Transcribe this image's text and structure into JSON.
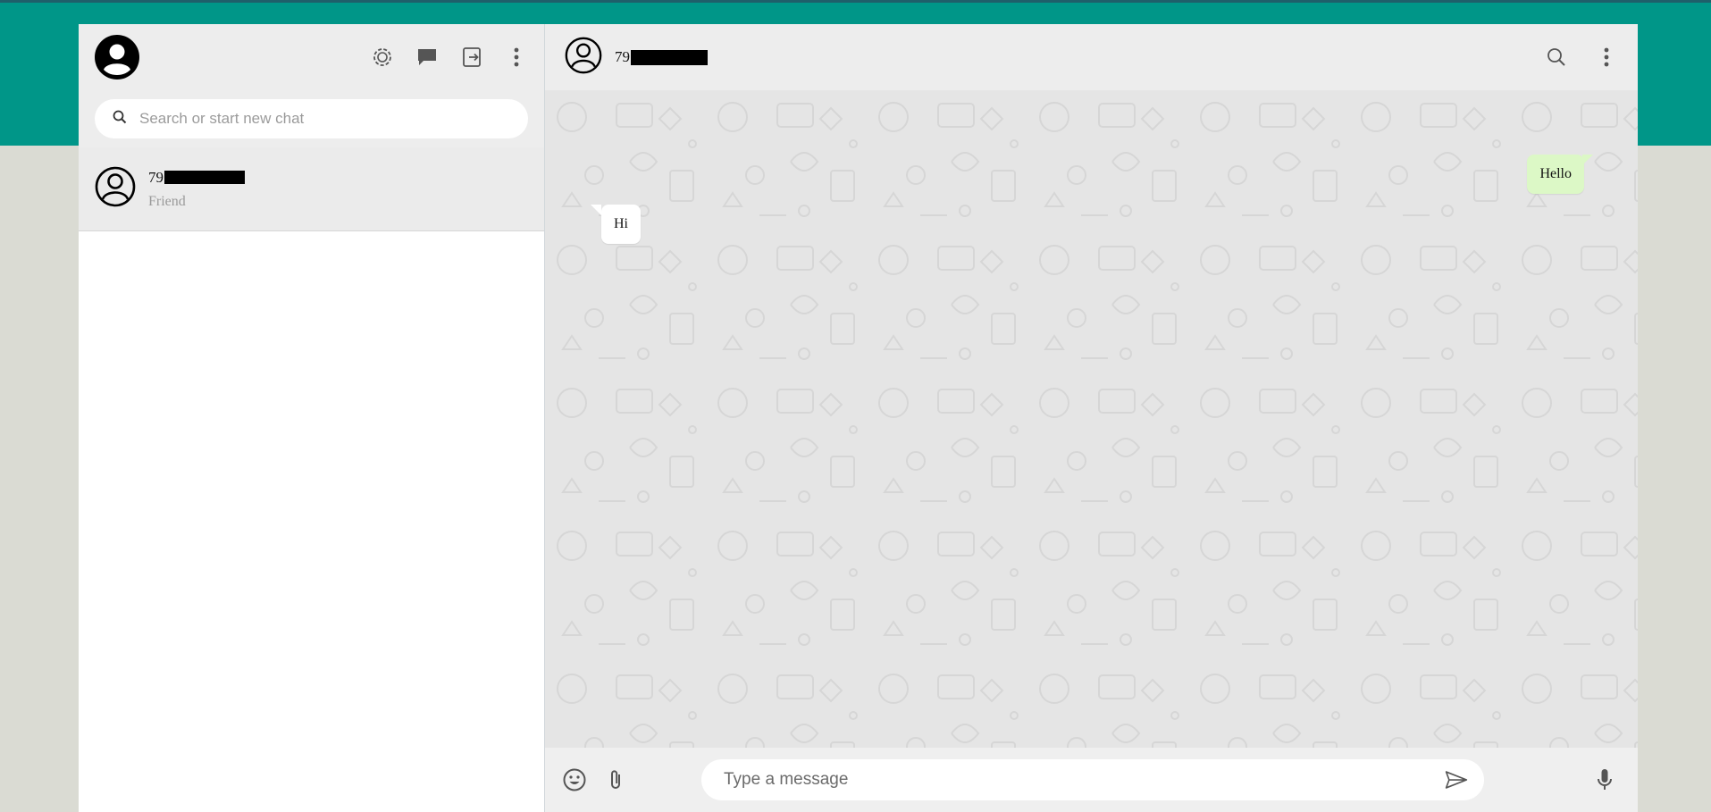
{
  "sidebar": {
    "search_placeholder": "Search or start new chat",
    "chats": [
      {
        "name_prefix": "79",
        "status": "Friend"
      }
    ]
  },
  "conversation": {
    "title_prefix": "79",
    "messages": [
      {
        "direction": "outgoing",
        "text": "Hello"
      },
      {
        "direction": "incoming",
        "text": "Hi"
      }
    ],
    "composer_placeholder": "Type a message"
  },
  "colors": {
    "top_band": "#009688",
    "outgoing_bubble": "#dcf8c6",
    "incoming_bubble": "#ffffff",
    "page_background": "#dadbd3"
  },
  "icons": {
    "sidebar_header": [
      "user-avatar-icon",
      "status-icon",
      "new-chat-icon",
      "logout-icon",
      "menu-icon"
    ],
    "conversation_header": [
      "contact-avatar-icon",
      "search-icon",
      "menu-icon"
    ],
    "composer": [
      "emoji-icon",
      "attach-icon",
      "send-icon",
      "mic-icon"
    ]
  }
}
